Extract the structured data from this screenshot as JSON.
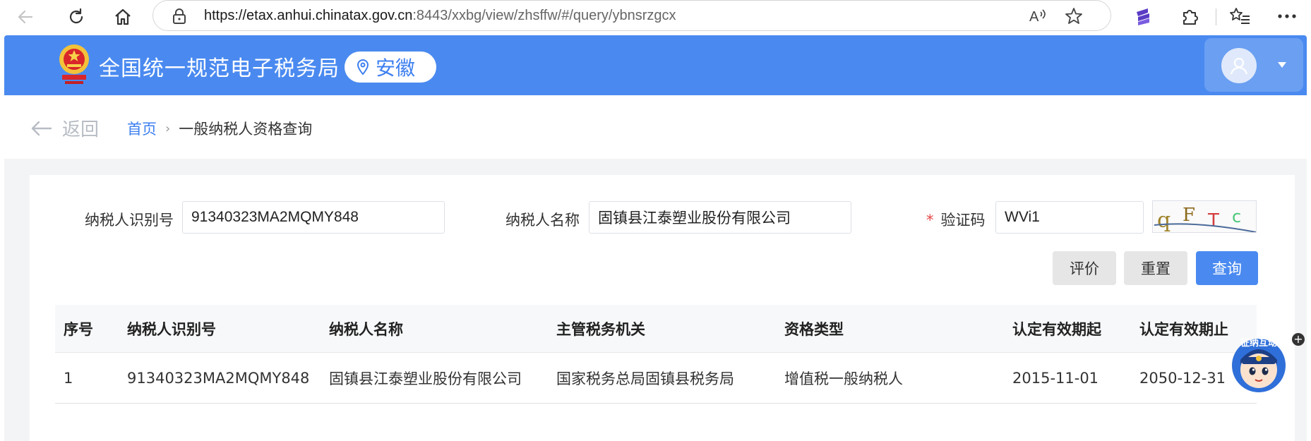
{
  "browser": {
    "url_host": "https://etax.anhui.chinatax.gov.cn",
    "url_rest": ":8443/xxbg/view/zhsffw/#/query/ybnsrzgcx"
  },
  "header": {
    "site_title": "全国统一规范电子税务局",
    "region": "安徽",
    "accent_color": "#4a8af0"
  },
  "breadcrumb": {
    "back_label": "返回",
    "home": "首页",
    "separator": "›",
    "current": "一般纳税人资格查询"
  },
  "form": {
    "taxpayer_id_label": "纳税人识别号",
    "taxpayer_id_value": "91340323MA2MQMY848",
    "taxpayer_name_label": "纳税人名称",
    "taxpayer_name_value": "固镇县江泰塑业股份有限公司",
    "required_mark": "*",
    "captcha_label": "验证码",
    "captcha_value": "WVi1",
    "captcha_image_chars": [
      "q",
      "F",
      "T",
      "c"
    ]
  },
  "buttons": {
    "rate": "评价",
    "reset": "重置",
    "query": "查询"
  },
  "table": {
    "columns": [
      "序号",
      "纳税人识别号",
      "纳税人名称",
      "主管税务机关",
      "资格类型",
      "认定有效期起",
      "认定有效期止"
    ],
    "rows": [
      [
        "1",
        "91340323MA2MQMY848",
        "固镇县江泰塑业股份有限公司",
        "国家税务总局固镇县税务局",
        "增值税一般纳税人",
        "2015-11-01",
        "2050-12-31"
      ]
    ]
  },
  "widget": {
    "badge_text": "征纳互动",
    "plus": "+"
  }
}
